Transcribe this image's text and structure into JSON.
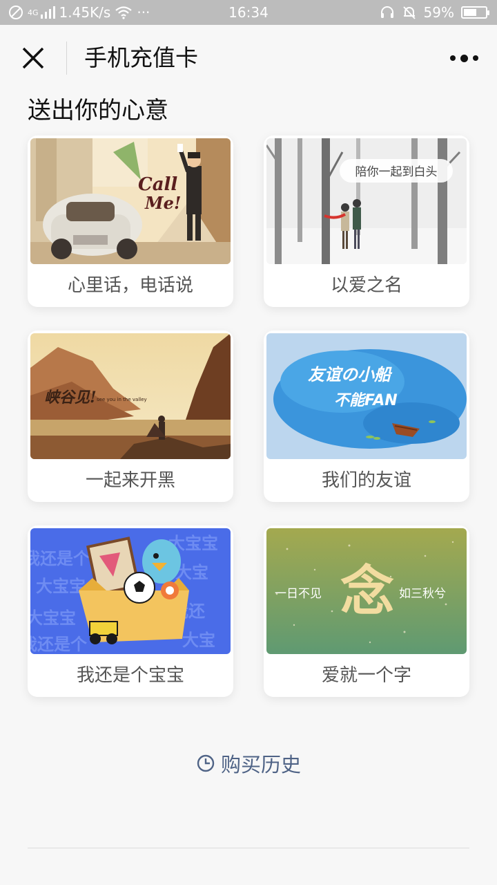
{
  "status_bar": {
    "network_speed": "1.45K/s",
    "signal_label": "4G",
    "dots": "···",
    "time": "16:34",
    "battery": "59%",
    "battery_level": 0.59
  },
  "nav": {
    "title": "手机充值卡"
  },
  "section_title": "送出你的心意",
  "cards": [
    {
      "label": "心里话，电话说",
      "art_text": "Call Me!"
    },
    {
      "label": "以爱之名",
      "art_text": "陪你一起到白头"
    },
    {
      "label": "一起来开黑",
      "art_text": "峡谷见!",
      "art_subtext": "see you in the valley"
    },
    {
      "label": "我们的友谊",
      "art_text": "友谊の小船",
      "art_text2": "不能FAN"
    },
    {
      "label": "我还是个宝宝",
      "art_text": "大宝宝",
      "art_text2": "我还是个"
    },
    {
      "label": "爱就一个字",
      "art_text": "念",
      "art_left": "一日不见",
      "art_right": "如三秋兮"
    }
  ],
  "history_label": "购买历史",
  "colors": {
    "status_bg": "#bcbcbc",
    "page_bg": "#f7f7f7",
    "link": "#4f6386"
  }
}
